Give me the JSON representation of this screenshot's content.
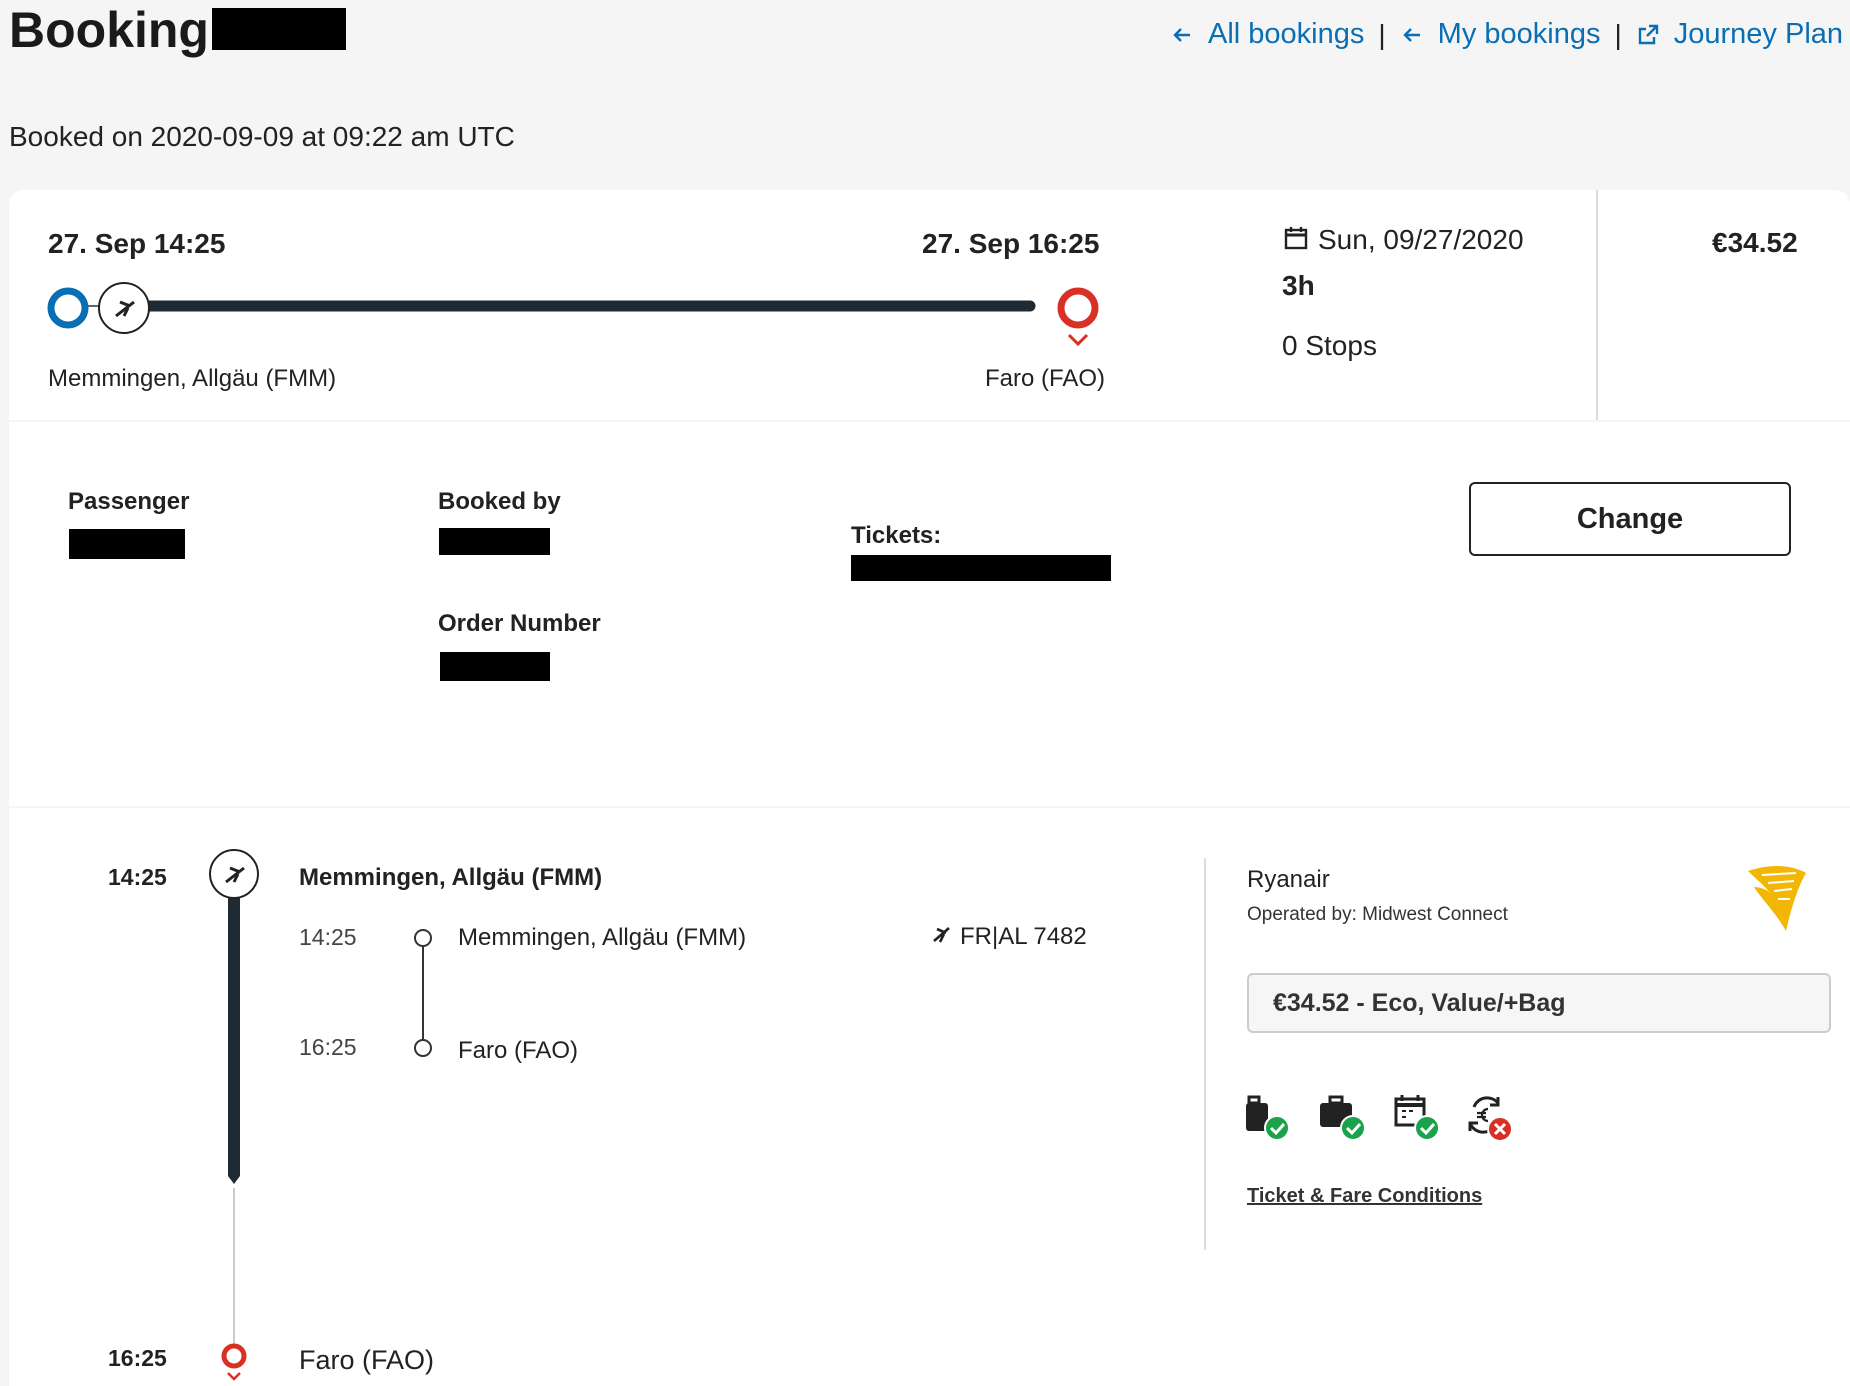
{
  "header": {
    "title": "Booking",
    "booked_on": "Booked on 2020-09-09 at 09:22 am UTC",
    "nav": {
      "all_bookings": "All bookings",
      "my_bookings": "My bookings",
      "journey_plan": "Journey Plan",
      "separator": "|"
    }
  },
  "summary": {
    "depart_datetime": "27. Sep 14:25",
    "arrive_datetime": "27. Sep 16:25",
    "depart_city": "Memmingen, Allgäu (FMM)",
    "arrive_city": "Faro (FAO)",
    "date": "Sun, 09/27/2020",
    "duration": "3h",
    "stops": "0 Stops",
    "price": "€34.52"
  },
  "details": {
    "passenger_label": "Passenger",
    "booked_by_label": "Booked by",
    "order_number_label": "Order Number",
    "tickets_label": "Tickets:",
    "change_button": "Change"
  },
  "itinerary": {
    "start_time": "14:25",
    "start_city": "Memmingen, Allgäu (FMM)",
    "end_time": "16:25",
    "end_city": "Faro (FAO)",
    "segment": {
      "dep_time": "14:25",
      "dep_city": "Memmingen, Allgäu (FMM)",
      "arr_time": "16:25",
      "arr_city": "Faro (FAO)",
      "flight_number": "FR|AL 7482"
    }
  },
  "carrier": {
    "name": "Ryanair",
    "operated_by": "Operated by: Midwest Connect",
    "fare": "€34.52 - Eco, Value/+Bag",
    "conditions_link": "Ticket & Fare Conditions",
    "features": [
      {
        "icon": "cabin-bag-icon",
        "included": true
      },
      {
        "icon": "checked-bag-icon",
        "included": true
      },
      {
        "icon": "rebooking-calendar-icon",
        "included": true
      },
      {
        "icon": "refund-euro-icon",
        "included": false
      }
    ]
  },
  "colors": {
    "link": "#0a6eb4",
    "origin": "#0a6eb4",
    "destination": "#d93025",
    "ok": "#1aa34a",
    "no": "#d93025",
    "brand": "#f2b705"
  }
}
